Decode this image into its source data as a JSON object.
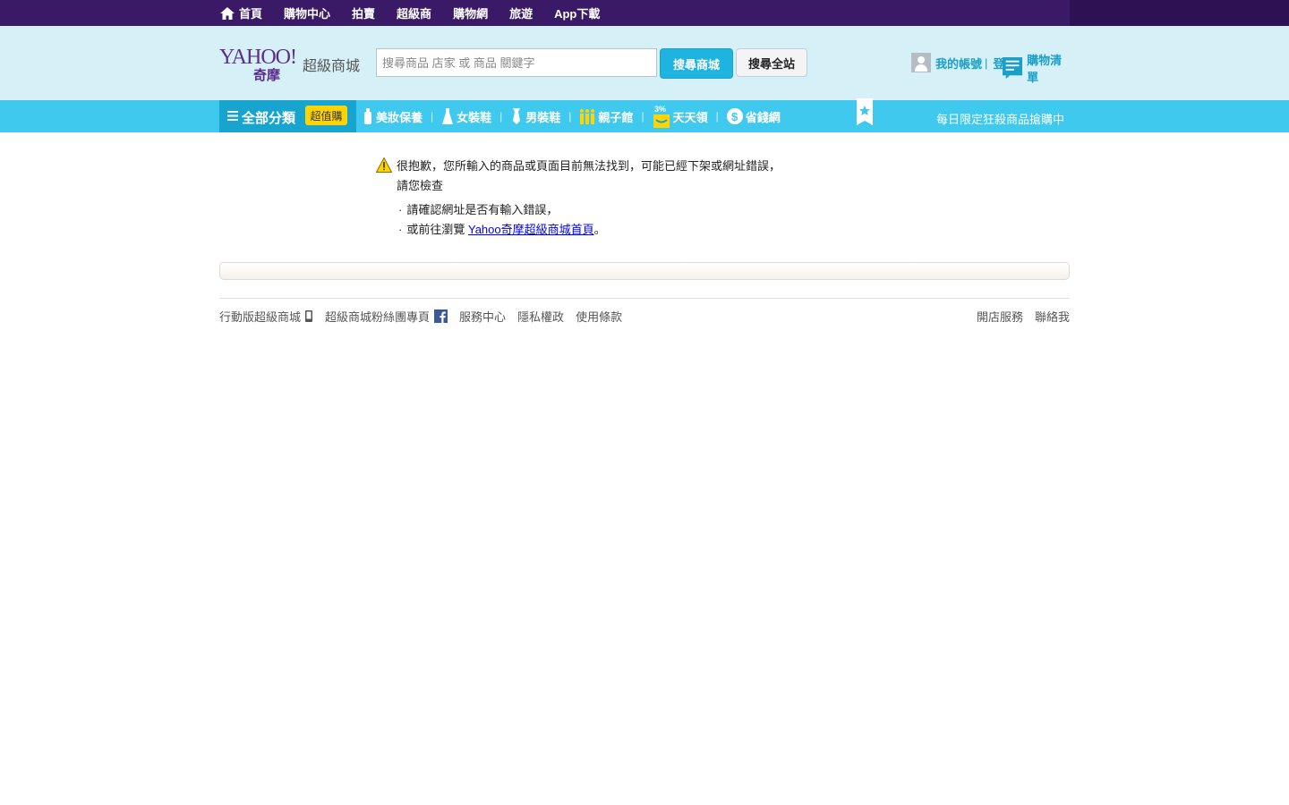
{
  "topnav": {
    "items": [
      "首頁",
      "購物中心",
      "拍賣",
      "超級商",
      "購物網",
      "旅遊",
      "App下載"
    ]
  },
  "header": {
    "logo_main": "YAHOO!",
    "logo_sub": "奇摩",
    "logo_mall": "超級商城",
    "search_placeholder": "搜尋商品 店家 或 商品 關鍵字",
    "search_button": "搜尋商城",
    "search_web_button": "搜尋全站",
    "login": "我的帳號",
    "logout": "登出",
    "cart": "購物清單"
  },
  "catbar": {
    "all_label": "全部分類",
    "promo_label": "超值購",
    "items": [
      "美妝保養",
      "女裝鞋",
      "男裝鞋",
      "親子館",
      "天天領",
      "省錢網"
    ],
    "promo_link": "每日限定狂殺商品搶購中"
  },
  "message": {
    "line1": "很抱歉，您所輸入的商品或頁面目前無法找到，可能已經下架或網址錯誤，",
    "line2": "請您檢查",
    "tip1": "請確認網址是否有輸入錯誤，",
    "tip2_prefix": "或前往瀏覽",
    "tip2_link": "Yahoo奇摩超級商城首頁",
    "tip2_suffix": "。"
  },
  "footer": {
    "left": [
      "行動版超級商城",
      "超級商城粉絲團專頁",
      "服務中心",
      "隱私權政",
      "使用條款"
    ],
    "right": [
      "開店服務",
      "聯絡我"
    ]
  },
  "colors": {
    "topbar": "#2d1152",
    "header_bg": "#d6f0f7",
    "catbar": "#40c9ee",
    "catbar_dark": "#17a4cf",
    "accent": "#1fb3e0",
    "promo": "#ffd400"
  }
}
